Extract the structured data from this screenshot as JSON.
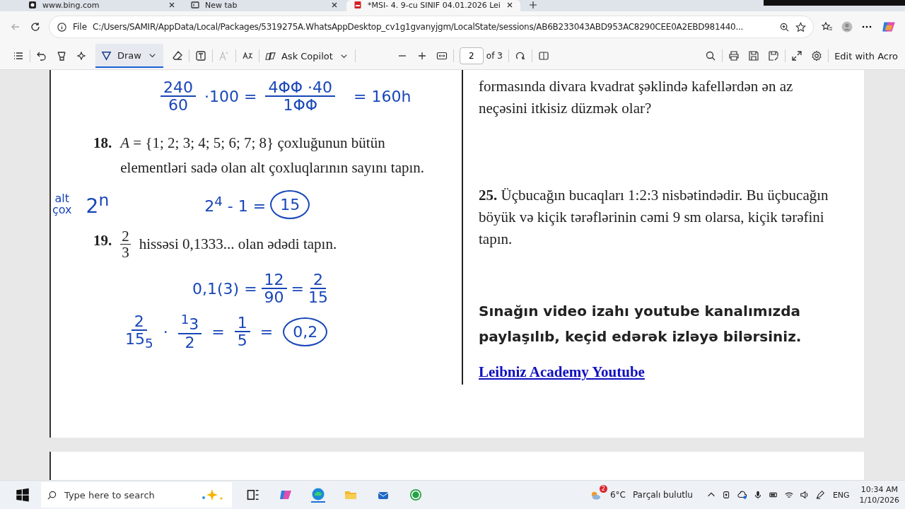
{
  "tabs": [
    {
      "title": "www.bing.com",
      "selected": false
    },
    {
      "title": "New tab",
      "selected": false
    },
    {
      "title": "*MSI- 4. 9-cu SINIF 04.01.2026 Lei",
      "selected": true
    }
  ],
  "address_bar": {
    "scheme": "File",
    "url": "C:/Users/SAMIR/AppData/Local/Packages/5319275A.WhatsAppDesktop_cv1g1gvanyjgm/LocalState/sessions/AB6B233043ABD953AC8290CEE0A2EBD981440..."
  },
  "pdf_toolbar": {
    "draw": {
      "label": "Draw",
      "selected": true
    },
    "copilot": "Ask Copilot",
    "page": "2",
    "page_count": "of 3",
    "edit": "Edit with Acro"
  },
  "left_column": [
    {
      "kind": "ink",
      "tokens": [
        {
          "kind": "frac",
          "num": "240",
          "den": "60"
        },
        {
          "kind": "text",
          "text": "·100 ="
        },
        {
          "kind": "frac",
          "num": "4ΦΦ ·40",
          "den": "1ΦΦ"
        },
        {
          "kind": "text",
          "text": "= 160h"
        }
      ]
    },
    {
      "kind": "question",
      "number": "18.",
      "text": "*A* = {1; 2; 3; 4; 5; 6; 7; 8} çoxluğunun bütün elementləri sadə olan alt çoxluqlarının sayını tapın."
    },
    {
      "kind": "ink",
      "tokens": [
        {
          "kind": "stack",
          "num": "alt",
          "den": "çox"
        },
        {
          "kind": "text",
          "text": "2$^{n}$"
        },
        {
          "kind": "text",
          "text": "2$^{4}$ - 1 ="
        },
        {
          "kind": "circled",
          "text": "15"
        }
      ]
    },
    {
      "kind": "question",
      "number": "19.",
      "frac": {
        "num": "2",
        "den": "3"
      },
      "text": "hissəsi 0,1333... olan ədədi tapın."
    },
    {
      "kind": "ink",
      "tokens": [
        {
          "kind": "text",
          "text": "0,1(3) ="
        },
        {
          "kind": "frac",
          "num": "12",
          "den": "90"
        },
        {
          "kind": "text",
          "text": "="
        },
        {
          "kind": "frac",
          "num": "2",
          "den": "15"
        }
      ]
    },
    {
      "kind": "ink",
      "tokens": [
        {
          "kind": "frac",
          "num": "2",
          "den": "15$_{5}$"
        },
        {
          "kind": "text",
          "text": "·"
        },
        {
          "kind": "frac",
          "num": "$^{1}$3",
          "den": "2"
        },
        {
          "kind": "text",
          "text": "="
        },
        {
          "kind": "frac",
          "num": "1",
          "den": "5"
        },
        {
          "kind": "text",
          "text": "="
        },
        {
          "kind": "circled",
          "text": "0,2"
        }
      ]
    }
  ],
  "right_column": [
    {
      "kind": "question",
      "text": "formasında divara kvadrat şəklində kafellərdən ən az neçəsini itkisiz düzmək olar?"
    },
    {
      "kind": "question",
      "number": "25.",
      "text": "Üçbucağın bucaqları 1:2:3 nisbətindədir. Bu üçbucağın böyük və kiçik tərəflərinin cəmi 9 sm olarsa, kiçik tərəfini tapın."
    },
    {
      "kind": "notice",
      "text": "Sınağın video izahı youtube kanalımızda paylaşılıb, keçid edərək izləyə bilərsiniz."
    },
    {
      "kind": "link",
      "text": "Leibniz Academy Youtube"
    }
  ],
  "taskbar": {
    "search_placeholder": "Type here to search",
    "temperature": "6°C",
    "weather": "Parçalı bulutlu",
    "weather_badge": "2",
    "language": "ENG",
    "time": "10:34 AM",
    "date": "1/10/2026"
  }
}
